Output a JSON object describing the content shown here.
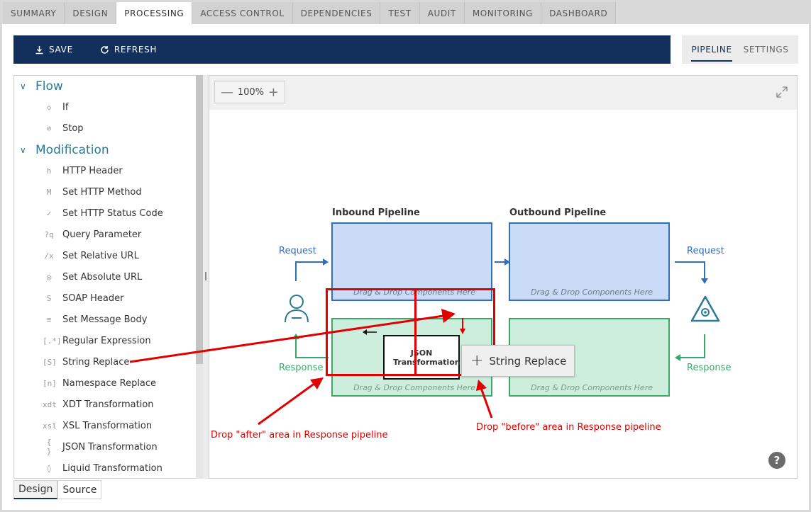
{
  "top_tabs": [
    "SUMMARY",
    "DESIGN",
    "PROCESSING",
    "ACCESS CONTROL",
    "DEPENDENCIES",
    "TEST",
    "AUDIT",
    "MONITORING",
    "DASHBOARD"
  ],
  "active_tab": "PROCESSING",
  "toolbar": {
    "save_label": "SAVE",
    "refresh_label": "REFRESH",
    "save_icon": "download-icon",
    "refresh_icon": "refresh-icon",
    "bg_color": "#13305c"
  },
  "view_tabs": {
    "pipeline": "PIPELINE",
    "settings": "SETTINGS",
    "active": "PIPELINE"
  },
  "tree": {
    "groups": [
      {
        "label": "Flow",
        "items": [
          {
            "label": "If",
            "icon": "diamond-icon"
          },
          {
            "label": "Stop",
            "icon": "stop-icon"
          }
        ]
      },
      {
        "label": "Modification",
        "items": [
          {
            "label": "HTTP Header",
            "icon": "header-icon",
            "glyph": "h"
          },
          {
            "label": "Set HTTP Method",
            "icon": "method-icon",
            "glyph": "M"
          },
          {
            "label": "Set HTTP Status Code",
            "icon": "status-icon",
            "glyph": "✓"
          },
          {
            "label": "Query Parameter",
            "icon": "query-icon",
            "glyph": "?q"
          },
          {
            "label": "Set Relative URL",
            "icon": "relative-url-icon",
            "glyph": "/x"
          },
          {
            "label": "Set Absolute URL",
            "icon": "globe-icon",
            "glyph": "◎"
          },
          {
            "label": "SOAP Header",
            "icon": "soap-icon",
            "glyph": "S"
          },
          {
            "label": "Set Message Body",
            "icon": "body-icon",
            "glyph": "≡"
          },
          {
            "label": "Regular Expression",
            "icon": "regex-icon",
            "glyph": "[.*]"
          },
          {
            "label": "String Replace",
            "icon": "string-replace-icon",
            "glyph": "[S]"
          },
          {
            "label": "Namespace Replace",
            "icon": "namespace-icon",
            "glyph": "[n]"
          },
          {
            "label": "XDT Transformation",
            "icon": "xdt-icon",
            "glyph": "xdt"
          },
          {
            "label": "XSL Transformation",
            "icon": "xsl-icon",
            "glyph": "xsl"
          },
          {
            "label": "JSON Transformation",
            "icon": "json-icon",
            "glyph": "{ }"
          },
          {
            "label": "Liquid Transformation",
            "icon": "drop-icon",
            "glyph": "◊"
          }
        ]
      }
    ]
  },
  "bottom_tabs": {
    "design": "Design",
    "source": "Source",
    "active": "Design"
  },
  "canvas": {
    "zoom": "100%",
    "zoom_out": "—",
    "zoom_in": "+",
    "inbound_title": "Inbound Pipeline",
    "outbound_title": "Outbound Pipeline",
    "drop_hint": "Drag & Drop Components Here",
    "request_label": "Request",
    "response_label": "Response",
    "json_component": "JSON Transformation",
    "drag_item": "String Replace",
    "drag_plus": "+",
    "help": "?"
  },
  "annotations": {
    "after": "Drop \"after\" area in Response pipeline",
    "before": "Drop \"before\" area in Response pipeline",
    "color": "#e00000"
  },
  "colors": {
    "inbound_fill": "#c9dbf6",
    "inbound_border": "#2f6fc2",
    "response_fill": "#cdeedc",
    "response_border": "#3aa86b"
  }
}
